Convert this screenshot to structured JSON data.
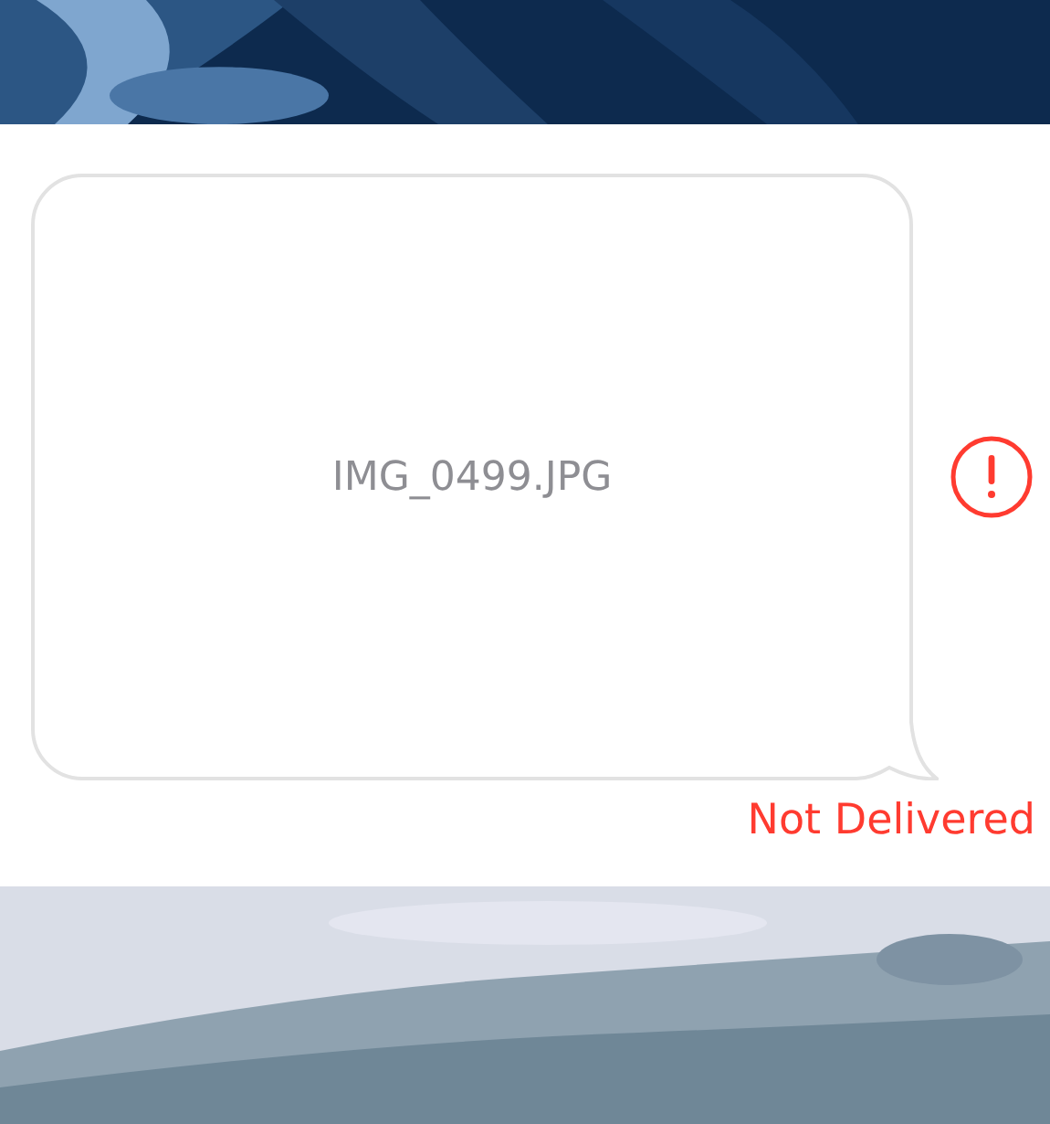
{
  "messages": [
    {
      "kind": "picture"
    },
    {
      "kind": "attachment",
      "filename": "IMG_0499.JPG",
      "failed": true,
      "status": "Not Delivered"
    },
    {
      "kind": "picture"
    }
  ]
}
